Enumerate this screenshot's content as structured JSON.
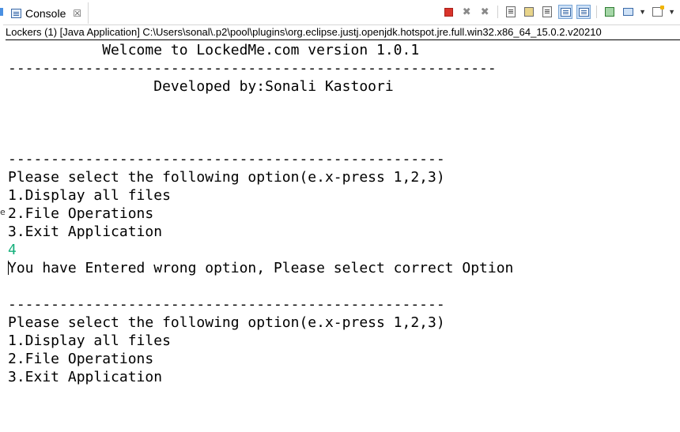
{
  "tab": {
    "label": "Console",
    "close_glyph": "☒"
  },
  "toolbar": {
    "icons": [
      "terminate-icon",
      "remove-launch-icon",
      "remove-all-terminated-icon",
      "clear-console-icon",
      "scroll-lock-icon",
      "word-wrap-icon",
      "show-console-on-stdout-icon",
      "show-console-on-stderr-icon",
      "pin-console-icon",
      "display-selected-console-icon",
      "open-console-icon"
    ]
  },
  "process_description": "Lockers (1) [Java Application] C:\\Users\\sonal\\.p2\\pool\\plugins\\org.eclipse.justj.openjdk.hotspot.jre.full.win32.x86_64_15.0.2.v20210",
  "console_lines": [
    "           Welcome to LockedMe.com version 1.0.1",
    "---------------------------------------------------------",
    "                 Developed by:Sonali Kastoori",
    "",
    "",
    "",
    "---------------------------------------------------",
    "Please select the following option(e.x-press 1,2,3)",
    "1.Display all files",
    "2.File Operations",
    "3.Exit Application",
    "4",
    "You have Entered wrong option, Please select correct Option",
    "",
    "---------------------------------------------------",
    "Please select the following option(e.x-press 1,2,3)",
    "1.Display all files",
    "2.File Operations",
    "3.Exit Application"
  ],
  "user_input_color": "#15b07b",
  "gutter_glyph": "e"
}
